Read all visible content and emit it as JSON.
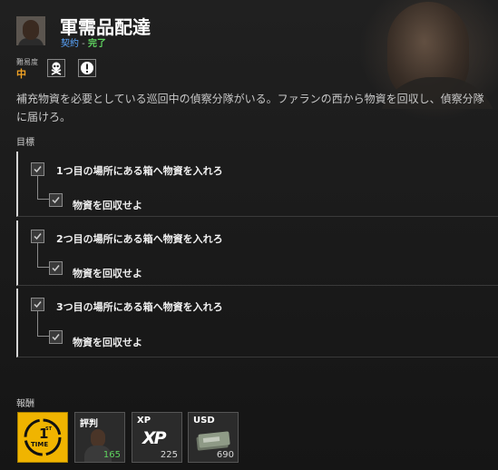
{
  "header": {
    "title": "軍需品配達",
    "contract_type": "契約",
    "separator": " - ",
    "status": "完了"
  },
  "difficulty": {
    "label": "難易度",
    "value": "中",
    "modifier_icons": [
      "skull-crossbones-icon",
      "alert-icon"
    ]
  },
  "description": "補充物資を必要としている巡回中の偵察分隊がいる。ファランの西から物資を回収し、偵察分隊に届けろ。",
  "objectives": {
    "label": "目標",
    "groups": [
      {
        "main": "1つ目の場所にある箱へ物資を入れろ",
        "sub": "物資を回収せよ"
      },
      {
        "main": "2つ目の場所にある箱へ物資を入れろ",
        "sub": "物資を回収せよ"
      },
      {
        "main": "3つ目の場所にある箱へ物資を入れろ",
        "sub": "物資を回収せよ"
      }
    ]
  },
  "rewards": {
    "label": "報酬",
    "first_time": {
      "top": "1",
      "sup": "ST",
      "bottom": "TIME"
    },
    "reputation": {
      "title": "評判",
      "amount": "165"
    },
    "xp": {
      "title": "XP",
      "logo": "XP",
      "amount": "225"
    },
    "usd": {
      "title": "USD",
      "amount": "690"
    }
  },
  "colors": {
    "status_blue": "#5aa6ff",
    "status_green": "#5fd35f",
    "difficulty_orange": "#f0a224",
    "first_time_yellow": "#f0b400"
  }
}
